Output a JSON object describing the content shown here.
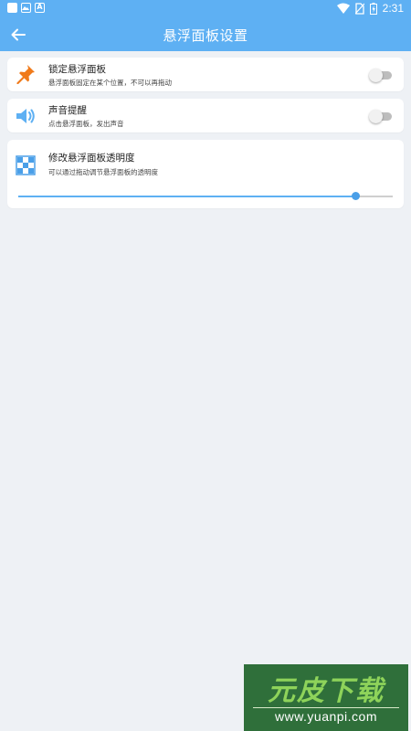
{
  "status_bar": {
    "time": "2:31",
    "left_icons": [
      "square-icon",
      "image-icon",
      "a-icon"
    ],
    "right_icons": [
      "wifi-icon",
      "no-sim-icon",
      "battery-icon"
    ]
  },
  "app_bar": {
    "title": "悬浮面板设置",
    "back_icon": "arrow-left-icon"
  },
  "settings": [
    {
      "label": "锁定悬浮面板",
      "description": "悬浮面板固定在某个位置，不可以再拖动",
      "icon": "pin-icon",
      "toggle_on": false
    },
    {
      "label": "声音提醒",
      "description": "点击悬浮面板，发出声音",
      "icon": "speaker-icon",
      "toggle_on": false
    }
  ],
  "opacity": {
    "label": "修改悬浮面板透明度",
    "description": "可以通过拖动调节悬浮面板的透明度",
    "icon": "checkerboard-icon",
    "slider_fraction": 0.9
  },
  "watermark": {
    "title": "元皮下载",
    "url": "www.yuanpi.com"
  },
  "colors": {
    "primary": "#5eb0f3",
    "background": "#eef1f5",
    "card": "#ffffff",
    "pin": "#f07a1a",
    "speaker": "#5eb0f3"
  }
}
